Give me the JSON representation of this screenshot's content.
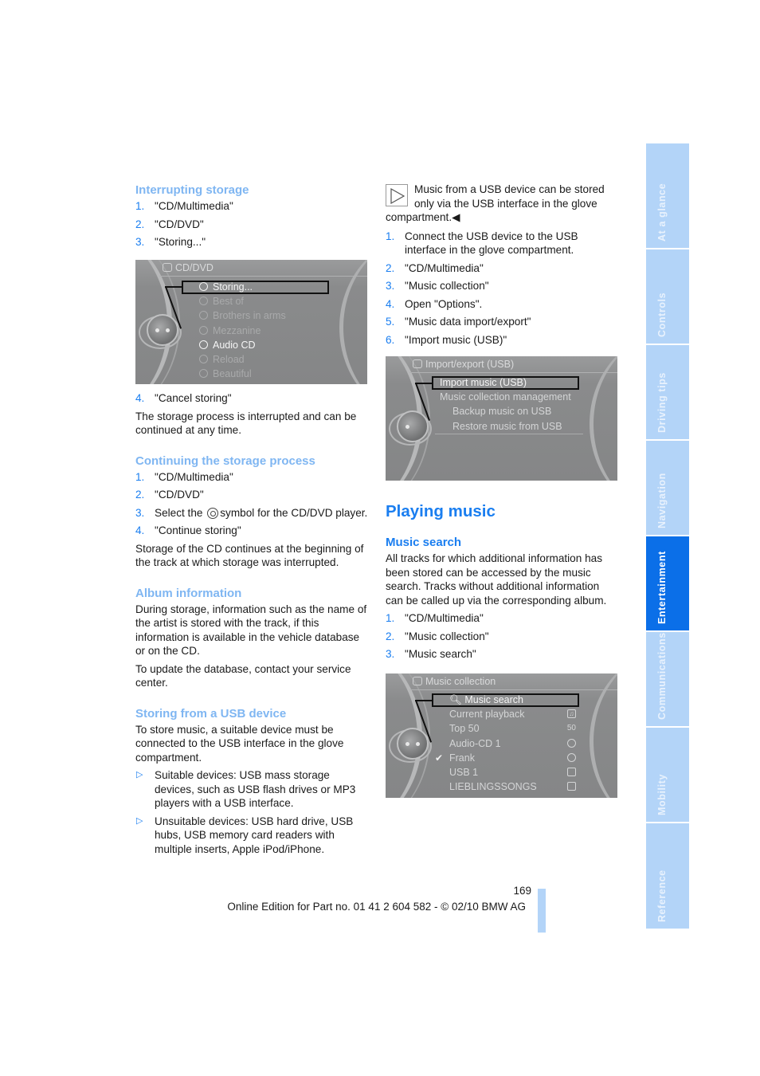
{
  "left_column": {
    "interrupting": {
      "heading": "Interrupting storage",
      "steps": [
        {
          "num": "1.",
          "text": "\"CD/Multimedia\""
        },
        {
          "num": "2.",
          "text": "\"CD/DVD\""
        },
        {
          "num": "3.",
          "text": "\"Storing...\""
        }
      ],
      "screen": {
        "title": "CD/DVD",
        "items": [
          {
            "label": "Storing...",
            "state": "selected"
          },
          {
            "label": "Best of",
            "state": "dim"
          },
          {
            "label": "Brothers in arms",
            "state": "dim"
          },
          {
            "label": "Mezzanine",
            "state": "dim"
          },
          {
            "label": "Audio CD",
            "state": "bright"
          },
          {
            "label": "Reload",
            "state": "dim"
          },
          {
            "label": "Beautiful",
            "state": "dim"
          }
        ]
      },
      "step4": {
        "num": "4.",
        "text": "\"Cancel storing\""
      },
      "para": "The storage process is interrupted and can be continued at any time."
    },
    "continuing": {
      "heading": "Continuing the storage process",
      "steps": [
        {
          "num": "1.",
          "text": "\"CD/Multimedia\""
        },
        {
          "num": "2.",
          "text": "\"CD/DVD\""
        },
        {
          "num": "3.",
          "text_before": "Select the",
          "icon": "cd-symbol-icon",
          "text_after": "symbol for the CD/DVD player."
        },
        {
          "num": "4.",
          "text": "\"Continue storing\""
        }
      ],
      "para": "Storage of the CD continues at the beginning of the track at which storage was interrupted."
    },
    "album": {
      "heading": "Album information",
      "paras": [
        "During storage, information such as the name of the artist is stored with the track, if this information is available in the vehicle database or on the CD.",
        "To update the database, contact your service center."
      ]
    },
    "usb": {
      "heading": "Storing from a USB device",
      "para": "To store music, a suitable device must be connected to the USB interface in the glove compartment.",
      "bullets": [
        "Suitable devices: USB mass storage devices, such as USB flash drives or MP3 players with a USB interface.",
        "Unsuitable devices: USB hard drive, USB hubs, USB memory card readers with multiple inserts, Apple iPod/iPhone."
      ]
    }
  },
  "right_column": {
    "note": {
      "icon": "note-triangle-icon",
      "text": "Music from a USB device can be stored only via the USB interface in the glove compartment.",
      "end_mark": "◀"
    },
    "steps": [
      {
        "num": "1.",
        "text": "Connect the USB device to the USB interface in the glove compartment."
      },
      {
        "num": "2.",
        "text": "\"CD/Multimedia\""
      },
      {
        "num": "3.",
        "text": "\"Music collection\""
      },
      {
        "num": "4.",
        "text": "Open \"Options\"."
      },
      {
        "num": "5.",
        "text": "\"Music data import/export\""
      },
      {
        "num": "6.",
        "text": "\"Import music (USB)\""
      }
    ],
    "screen": {
      "title": "Import/export (USB)",
      "items": [
        {
          "label": "Import music (USB)",
          "state": "selected"
        },
        {
          "label": "Music collection management",
          "state": "normal"
        },
        {
          "label": "Backup music on USB",
          "state": "indent"
        },
        {
          "label": "Restore music from USB",
          "state": "indent"
        }
      ]
    },
    "playing": {
      "heading": "Playing music",
      "subheading": "Music search",
      "para": "All tracks for which additional information has been stored can be accessed by the music search. Tracks without additional information can be called up via the corresponding album.",
      "steps": [
        {
          "num": "1.",
          "text": "\"CD/Multimedia\""
        },
        {
          "num": "2.",
          "text": "\"Music collection\""
        },
        {
          "num": "3.",
          "text": "\"Music search\""
        }
      ],
      "screen": {
        "title": "Music collection",
        "items": [
          {
            "label": "Music search",
            "state": "selected",
            "left_icon": "search-icon"
          },
          {
            "label": "Current playback",
            "right_icon": "playback-icon"
          },
          {
            "label": "Top 50",
            "right_icon": "top50-icon",
            "right_text": "50"
          },
          {
            "label": "Audio-CD 1",
            "right_icon": "cd-icon"
          },
          {
            "label": "Frank",
            "checked": true,
            "right_icon": "cd-icon"
          },
          {
            "label": "USB 1",
            "right_icon": "usb-icon"
          },
          {
            "label": "LIEBLINGSSONGS",
            "right_icon": "playlist-icon"
          }
        ]
      }
    }
  },
  "side_tabs": [
    {
      "label": "At a glance",
      "active": false
    },
    {
      "label": "Controls",
      "active": false
    },
    {
      "label": "Driving tips",
      "active": false
    },
    {
      "label": "Navigation",
      "active": false
    },
    {
      "label": "Entertainment",
      "active": true
    },
    {
      "label": "Communications",
      "active": false
    },
    {
      "label": "Mobility",
      "active": false
    },
    {
      "label": "Reference",
      "active": false
    }
  ],
  "footer": {
    "page_number": "169",
    "edition": "Online Edition for Part no. 01 41 2 604 582 - © 02/10 BMW AG"
  },
  "colors": {
    "accent": "#1a7ef0",
    "heading_light": "#7fb6f2",
    "tab_inactive": "#b3d4f8",
    "tab_active": "#0b6fe8"
  }
}
